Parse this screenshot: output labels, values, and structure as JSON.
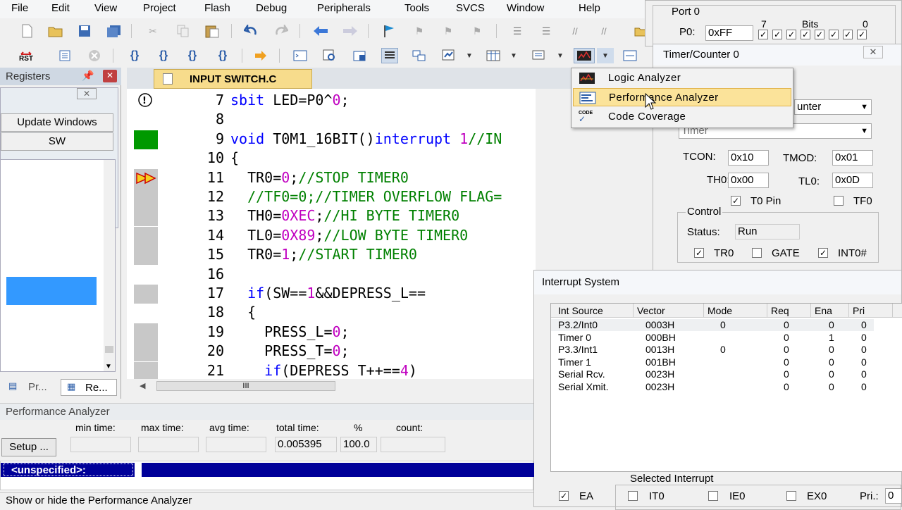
{
  "menu": [
    "File",
    "Edit",
    "View",
    "Project",
    "Flash",
    "Debug",
    "Peripherals",
    "Tools",
    "SVCS",
    "Window",
    "Help"
  ],
  "toolbar2": {
    "rst_label": "RST"
  },
  "registers": {
    "title": "Registers",
    "update_windows": "Update Windows",
    "sw_button": "SW",
    "tab_project": "Pr...",
    "tab_registers": "Re..."
  },
  "editor": {
    "tab_label": "INPUT SWITCH.C",
    "lines": [
      {
        "n": "7",
        "t": "sbit LED=P0^0;"
      },
      {
        "n": "8",
        "t": ""
      },
      {
        "n": "9",
        "t": "void T0M1_16BIT()interrupt 1//IN"
      },
      {
        "n": "10",
        "t": "{"
      },
      {
        "n": "11",
        "t": "  TR0=0;//STOP TIMER0"
      },
      {
        "n": "12",
        "t": "  //TF0=0;//TIMER OVERFLOW FLAG="
      },
      {
        "n": "13",
        "t": "  TH0=0XEC;//HI BYTE TIMER0"
      },
      {
        "n": "14",
        "t": "  TL0=0X89;//LOW BYTE TIMER0"
      },
      {
        "n": "15",
        "t": "  TR0=1;//START TIMER0"
      },
      {
        "n": "16",
        "t": ""
      },
      {
        "n": "17",
        "t": "  if(SW==1&&DEPRESS_L=="
      },
      {
        "n": "18",
        "t": "  {"
      },
      {
        "n": "19",
        "t": "    PRESS_L=0;"
      },
      {
        "n": "20",
        "t": "    PRESS_T=0;"
      },
      {
        "n": "21",
        "t": "    if(DEPRESS T++==4)"
      }
    ],
    "scroll_grip": "III"
  },
  "dropdown": {
    "items": [
      "Logic Analyzer",
      "Performance Analyzer",
      "Code Coverage"
    ],
    "selected": "Performance Analyzer",
    "code_icon_text": "CODE"
  },
  "port0": {
    "title": "Port 0",
    "p0_label": "P0:",
    "p0_value": "0xFF",
    "bits_label": "Bits",
    "bit_hi": "7",
    "bit_lo": "0"
  },
  "timer": {
    "title": "Timer/Counter 0",
    "mode_value": "unter",
    "mode2_value": "Timer",
    "tcon_label": "TCON:",
    "tcon_value": "0x10",
    "tmod_label": "TMOD:",
    "tmod_value": "0x01",
    "th0_label": "TH0:",
    "th0_value": "0x00",
    "tl0_label": "TL0:",
    "tl0_value": "0x0D",
    "t0pin_label": "T0 Pin",
    "tf0_label": "TF0",
    "control_label": "Control",
    "status_label": "Status:",
    "status_value": "Run",
    "tr0_label": "TR0",
    "gate_label": "GATE",
    "int0_label": "INT0#"
  },
  "interrupt": {
    "title": "Interrupt System",
    "columns": [
      "Int Source",
      "Vector",
      "Mode",
      "Req",
      "Ena",
      "Pri"
    ],
    "rows": [
      [
        "P3.2/Int0",
        "0003H",
        "0",
        "0",
        "0",
        "0"
      ],
      [
        "Timer 0",
        "000BH",
        "",
        "0",
        "1",
        "0"
      ],
      [
        "P3.3/Int1",
        "0013H",
        "0",
        "0",
        "0",
        "0"
      ],
      [
        "Timer 1",
        "001BH",
        "",
        "0",
        "0",
        "0"
      ],
      [
        "Serial Rcv.",
        "0023H",
        "",
        "0",
        "0",
        "0"
      ],
      [
        "Serial Xmit.",
        "0023H",
        "",
        "0",
        "0",
        "0"
      ]
    ],
    "selected_label": "Selected Interrupt",
    "ea_label": "EA",
    "it0_label": "IT0",
    "ie0_label": "IE0",
    "ex0_label": "EX0",
    "pri_label": "Pri.:",
    "pri_value": "0"
  },
  "perf": {
    "title": "Performance Analyzer",
    "setup_label": "Setup ...",
    "min_label": "min time:",
    "max_label": "max time:",
    "avg_label": "avg time:",
    "total_label": "total time:",
    "pct_label": "%",
    "count_label": "count:",
    "total_value": "0.005395",
    "pct_value": "100.0",
    "unspecified": "<unspecified>:"
  },
  "status_bar": "Show or hide the Performance Analyzer",
  "colors": {
    "accent": "#3399ff",
    "selected_bar": "#000099",
    "highlight": "#fbe39a"
  }
}
